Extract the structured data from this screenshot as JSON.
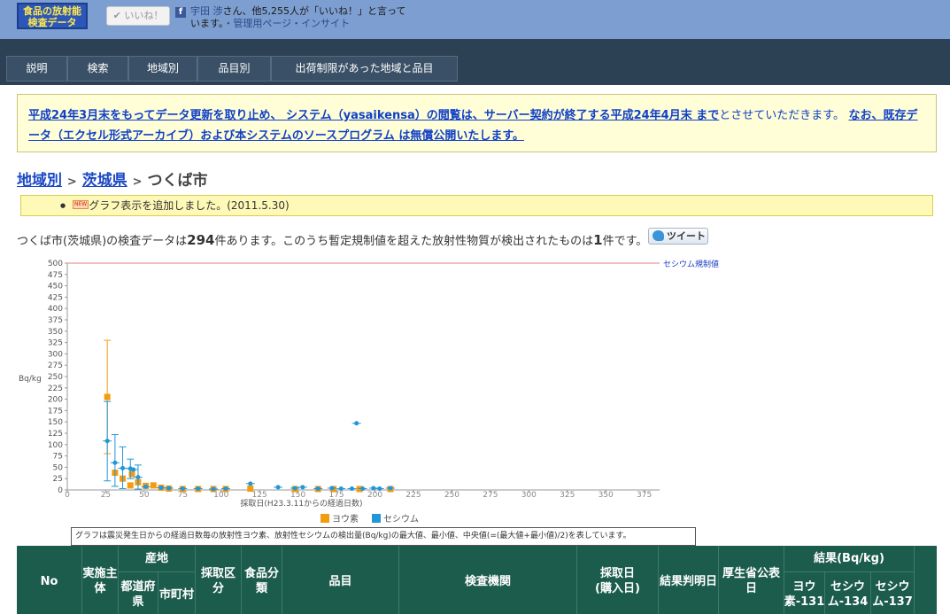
{
  "logo": {
    "line1": "食品の放射能",
    "line2": "検査データ"
  },
  "facebook": {
    "like_button": "✔ いいね！",
    "fb_icon": "facebook-logo",
    "text_name": "宇田 渉",
    "text_rest": "さん、他5,255人が「いいね！」と言って",
    "text_line2": "います。",
    "text_links": "・管理用ページ・インサイト"
  },
  "nav": {
    "items": [
      "説明",
      "検索",
      "地域別",
      "品目別",
      "出荷制限があった地域と品目"
    ]
  },
  "notice": {
    "link1": "平成24年3月末をもってデータ更新を取り止め、 システム（yasaikensa）の閲覧は、サーバー契約が終了する平成24年4月末 まで",
    "plain1": "とさせていただきます。",
    "link2a": "な",
    "link2b": "お、既存データ（エクセル形式アーカイブ）および本システムのソースプログラム は無償公開いたします。"
  },
  "breadcrumb": {
    "level1": "地域別",
    "sep": ">",
    "level2": "茨城県",
    "current": "つくば市"
  },
  "news": {
    "bullet": "●",
    "badge": "NEW",
    "text": "グラフ表示を追加しました。(2011.5.30)"
  },
  "summary": {
    "part1": "つくば市(茨城県)の検査データは",
    "count": "294",
    "part2": "件あります。このうち暫定規制値を超えた放射性物質が検出されたものは",
    "exceed": "1",
    "part3": "件です。"
  },
  "tweet": {
    "label": "ツイート",
    "icon": "twitter-bird-icon"
  },
  "chart_caption": "グラフは震災発生日からの経過日数毎の放射性ヨウ素、放射性セシウムの検出量(Bq/kg)の最大値、最小値、中央値(=(最大値+最小値)/2)を表しています。",
  "chart_data": {
    "type": "scatter",
    "xlabel": "採取日(H23.3.11からの経過日数)",
    "ylabel": "Bq/kg",
    "xlim": [
      0,
      385
    ],
    "ylim": [
      0,
      500
    ],
    "xticks": [
      0,
      25,
      50,
      75,
      100,
      125,
      150,
      175,
      200,
      225,
      250,
      275,
      300,
      325,
      350,
      375
    ],
    "yticks": [
      0,
      25,
      50,
      75,
      100,
      125,
      150,
      175,
      200,
      225,
      250,
      275,
      300,
      325,
      350,
      375,
      400,
      425,
      450,
      475,
      500
    ],
    "grid": false,
    "legend_position": "bottom",
    "reference_line": {
      "label": "セシウム規制値",
      "value": 500,
      "color": "#e08080"
    },
    "series": [
      {
        "name": "ヨウ素",
        "color": "#f39c12",
        "points": [
          {
            "x": 26,
            "mid": 205,
            "min": 80,
            "max": 330
          },
          {
            "x": 31,
            "mid": 38
          },
          {
            "x": 36,
            "mid": 25
          },
          {
            "x": 41,
            "mid": 10
          },
          {
            "x": 42,
            "mid": 35
          },
          {
            "x": 46,
            "mid": 17
          },
          {
            "x": 51,
            "mid": 9
          },
          {
            "x": 56,
            "mid": 10
          },
          {
            "x": 61,
            "mid": 5
          },
          {
            "x": 66,
            "mid": 3
          },
          {
            "x": 75,
            "mid": 2
          },
          {
            "x": 85,
            "mid": 2
          },
          {
            "x": 95,
            "mid": 2
          },
          {
            "x": 103,
            "mid": 2
          },
          {
            "x": 119,
            "mid": 3
          },
          {
            "x": 148,
            "mid": 2
          },
          {
            "x": 163,
            "mid": 2
          },
          {
            "x": 173,
            "mid": 2
          },
          {
            "x": 190,
            "mid": 2
          },
          {
            "x": 210,
            "mid": 2
          }
        ]
      },
      {
        "name": "セシウム",
        "color": "#2196d8",
        "points": [
          {
            "x": 26,
            "mid": 108,
            "min": 20,
            "max": 195
          },
          {
            "x": 31,
            "mid": 60,
            "min": 8,
            "max": 122
          },
          {
            "x": 36,
            "mid": 48,
            "min": 3,
            "max": 95
          },
          {
            "x": 41,
            "mid": 47,
            "min": 25,
            "max": 68
          },
          {
            "x": 43,
            "mid": 45
          },
          {
            "x": 46,
            "mid": 28,
            "min": 2,
            "max": 55
          },
          {
            "x": 51,
            "mid": 7
          },
          {
            "x": 61,
            "mid": 5
          },
          {
            "x": 66,
            "mid": 4
          },
          {
            "x": 75,
            "mid": 3
          },
          {
            "x": 85,
            "mid": 3
          },
          {
            "x": 95,
            "mid": 2
          },
          {
            "x": 103,
            "mid": 3
          },
          {
            "x": 119,
            "mid": 14
          },
          {
            "x": 137,
            "mid": 6
          },
          {
            "x": 148,
            "mid": 4
          },
          {
            "x": 153,
            "mid": 6
          },
          {
            "x": 163,
            "mid": 3
          },
          {
            "x": 172,
            "mid": 4
          },
          {
            "x": 178,
            "mid": 3
          },
          {
            "x": 185,
            "mid": 3
          },
          {
            "x": 188,
            "mid": 147
          },
          {
            "x": 192,
            "mid": 3
          },
          {
            "x": 199,
            "mid": 4
          },
          {
            "x": 203,
            "mid": 3
          },
          {
            "x": 210,
            "mid": 4
          }
        ]
      }
    ]
  },
  "table_header": {
    "no": "No",
    "implementer": "実施主体",
    "origin": "産地",
    "prefecture": "都道府県",
    "city": "市町村",
    "sampling_category": "採取区分",
    "food_category": "食品分類",
    "item": "品目",
    "lab": "検査機関",
    "sample_date": "採取日\n(購入日)",
    "result_date": "結果判明日",
    "mhlw_date": "厚生省公表日",
    "result": "結果(Bq/kg)",
    "iodine131": "ヨウ素-131",
    "cs134": "セシウム-134",
    "cs137": "セシウム-137"
  }
}
